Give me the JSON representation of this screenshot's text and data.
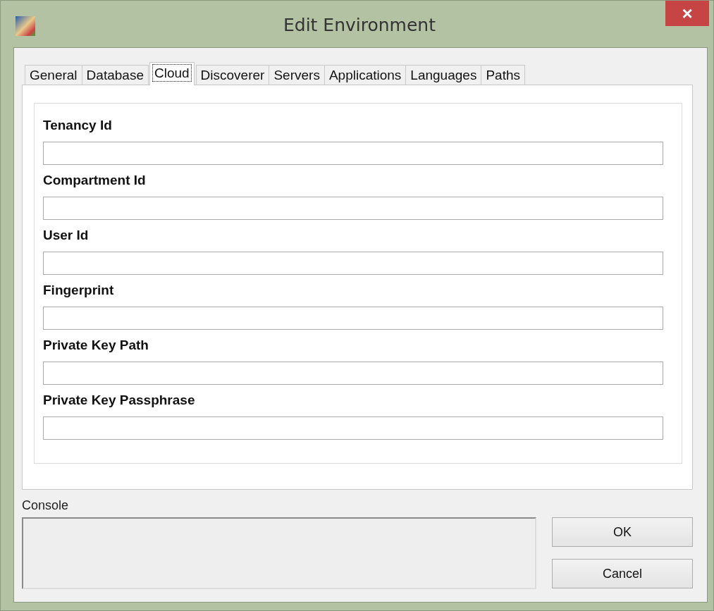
{
  "window": {
    "title": "Edit Environment",
    "close": "×"
  },
  "tabs": [
    {
      "label": "General",
      "selected": false
    },
    {
      "label": "Database",
      "selected": false
    },
    {
      "label": "Cloud",
      "selected": true
    },
    {
      "label": "Discoverer",
      "selected": false
    },
    {
      "label": "Servers",
      "selected": false
    },
    {
      "label": "Applications",
      "selected": false
    },
    {
      "label": "Languages",
      "selected": false
    },
    {
      "label": "Paths",
      "selected": false
    }
  ],
  "fields": [
    {
      "label": "Tenancy Id"
    },
    {
      "label": "Compartment Id"
    },
    {
      "label": "User Id"
    },
    {
      "label": "Fingerprint"
    },
    {
      "label": "Private Key Path"
    },
    {
      "label": "Private Key Passphrase"
    }
  ],
  "console": {
    "label": "Console"
  },
  "buttons": [
    "OK",
    "Cancel"
  ]
}
